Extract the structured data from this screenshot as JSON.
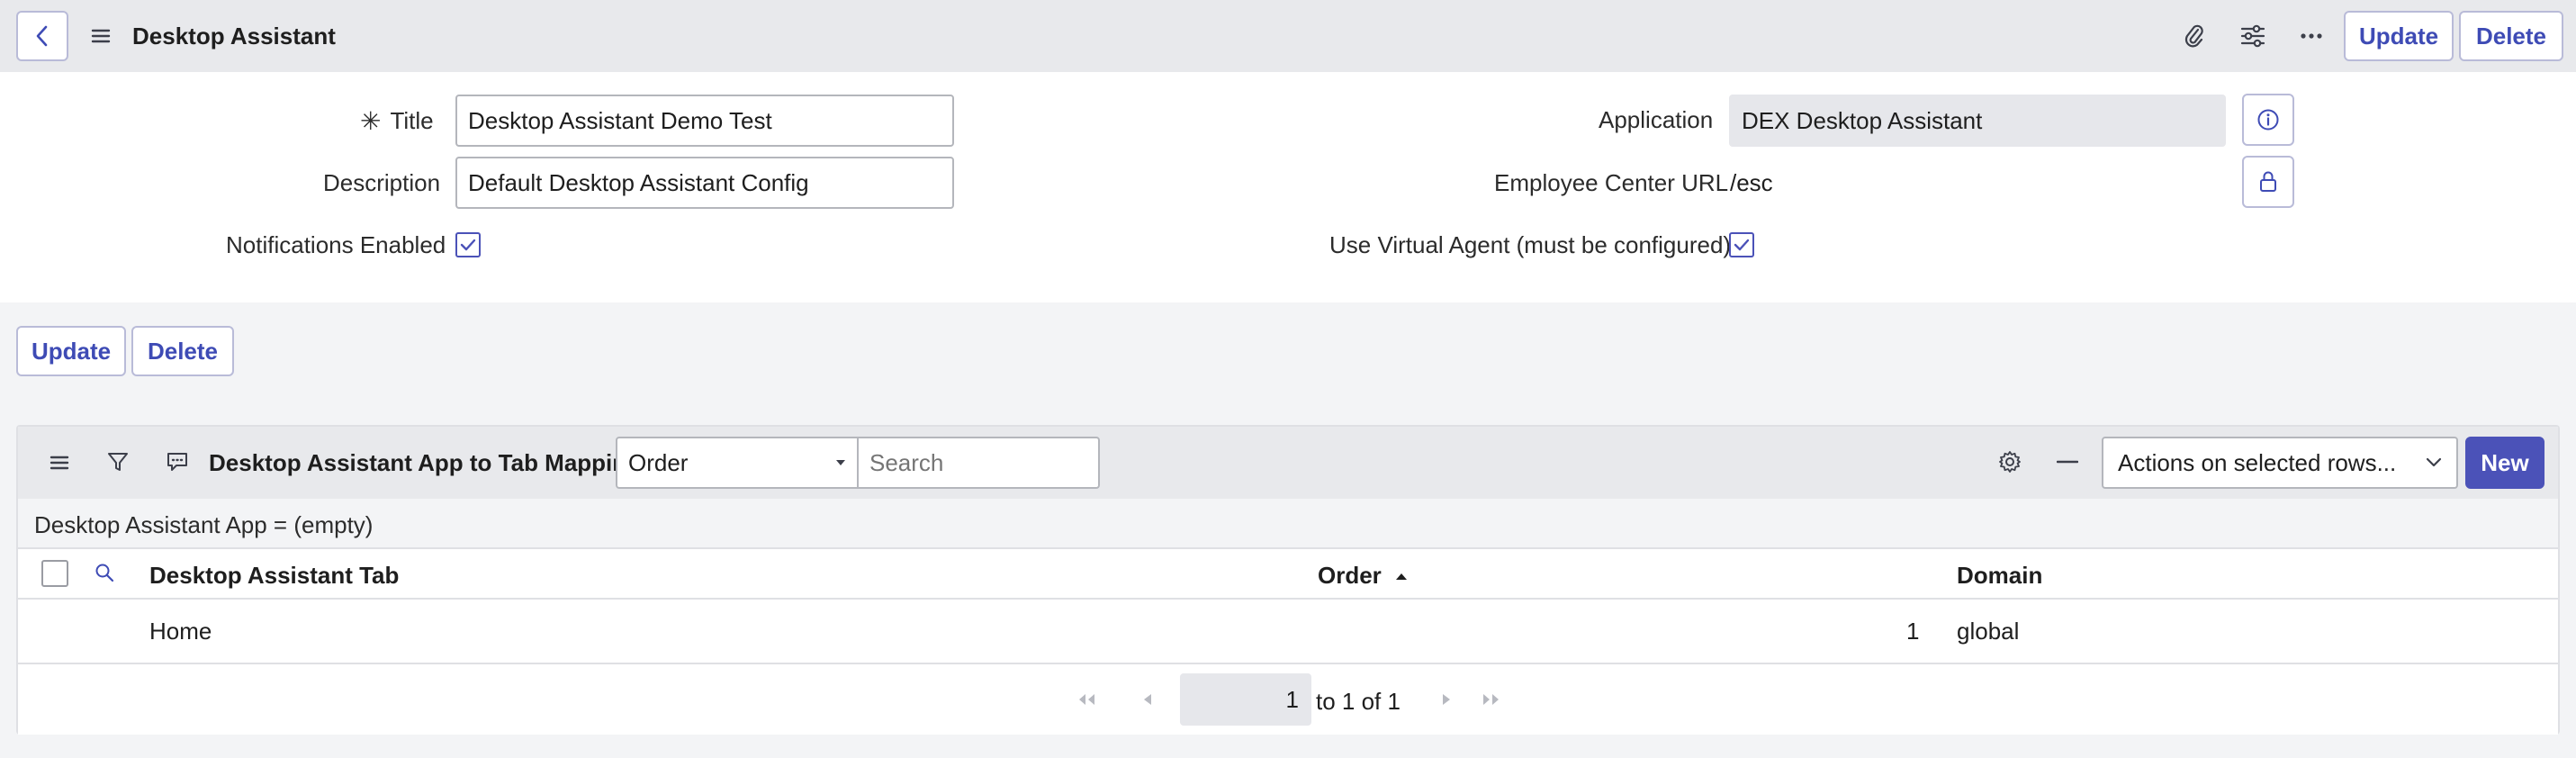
{
  "header": {
    "title": "Desktop Assistant",
    "update_label": "Update",
    "delete_label": "Delete"
  },
  "form": {
    "title_label": "Title",
    "title_value": "Desktop Assistant Demo Test",
    "description_label": "Description",
    "description_value": "Default Desktop Assistant Config",
    "notifications_label": "Notifications Enabled",
    "notifications_checked": true,
    "application_label": "Application",
    "application_value": "DEX Desktop Assistant",
    "ec_url_label": "Employee Center URL",
    "ec_url_value": "/esc",
    "virtual_agent_label": "Use Virtual Agent (must be configured)",
    "virtual_agent_checked": true
  },
  "form_buttons": {
    "update_label": "Update",
    "delete_label": "Delete"
  },
  "related_list": {
    "title": "Desktop Assistant App to Tab Mappings",
    "search_field": "Order",
    "search_placeholder": "Search",
    "actions_label": "Actions on selected rows...",
    "new_label": "New",
    "filter_text": "Desktop Assistant App = (empty)",
    "columns": [
      "Desktop Assistant Tab",
      "Order",
      "Domain"
    ],
    "rows": [
      {
        "tab": "Home",
        "order": "1",
        "domain": "global"
      }
    ],
    "pager": {
      "page": "1",
      "range_text": "to 1 of 1"
    }
  },
  "colors": {
    "accent": "#4b52b8",
    "link": "#3e4bb5",
    "header_bg": "#e8e9ec"
  }
}
